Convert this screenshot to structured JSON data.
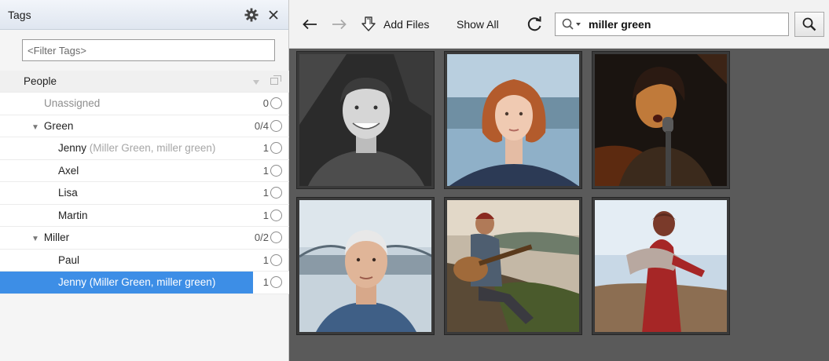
{
  "panel": {
    "title": "Tags",
    "filter_placeholder": "<Filter Tags>"
  },
  "tree": {
    "group_label": "People",
    "unassigned": {
      "label": "Unassigned",
      "count": "0"
    },
    "green": {
      "label": "Green",
      "count": "0/4",
      "children": [
        {
          "label": "Jenny",
          "alias": "(Miller Green, miller green)",
          "count": "1"
        },
        {
          "label": "Axel",
          "count": "1"
        },
        {
          "label": "Lisa",
          "count": "1"
        },
        {
          "label": "Martin",
          "count": "1"
        }
      ]
    },
    "miller": {
      "label": "Miller",
      "count": "0/2",
      "children": [
        {
          "label": "Paul",
          "count": "1"
        },
        {
          "label": "Jenny (Miller Green, miller green)",
          "count": "1",
          "selected": true
        }
      ]
    }
  },
  "toolbar": {
    "add_files_label": "Add Files",
    "show_all_label": "Show All",
    "search_value": "miller green"
  },
  "icons": {
    "back": "back-arrow-icon",
    "forward": "forward-arrow-icon",
    "add_files": "add-files-icon",
    "refresh": "refresh-icon",
    "search": "search-icon",
    "settings": "gear-icon",
    "close": "close-icon"
  },
  "colors": {
    "selection": "#3d8ee6",
    "grid_background": "#5a5a5a"
  }
}
